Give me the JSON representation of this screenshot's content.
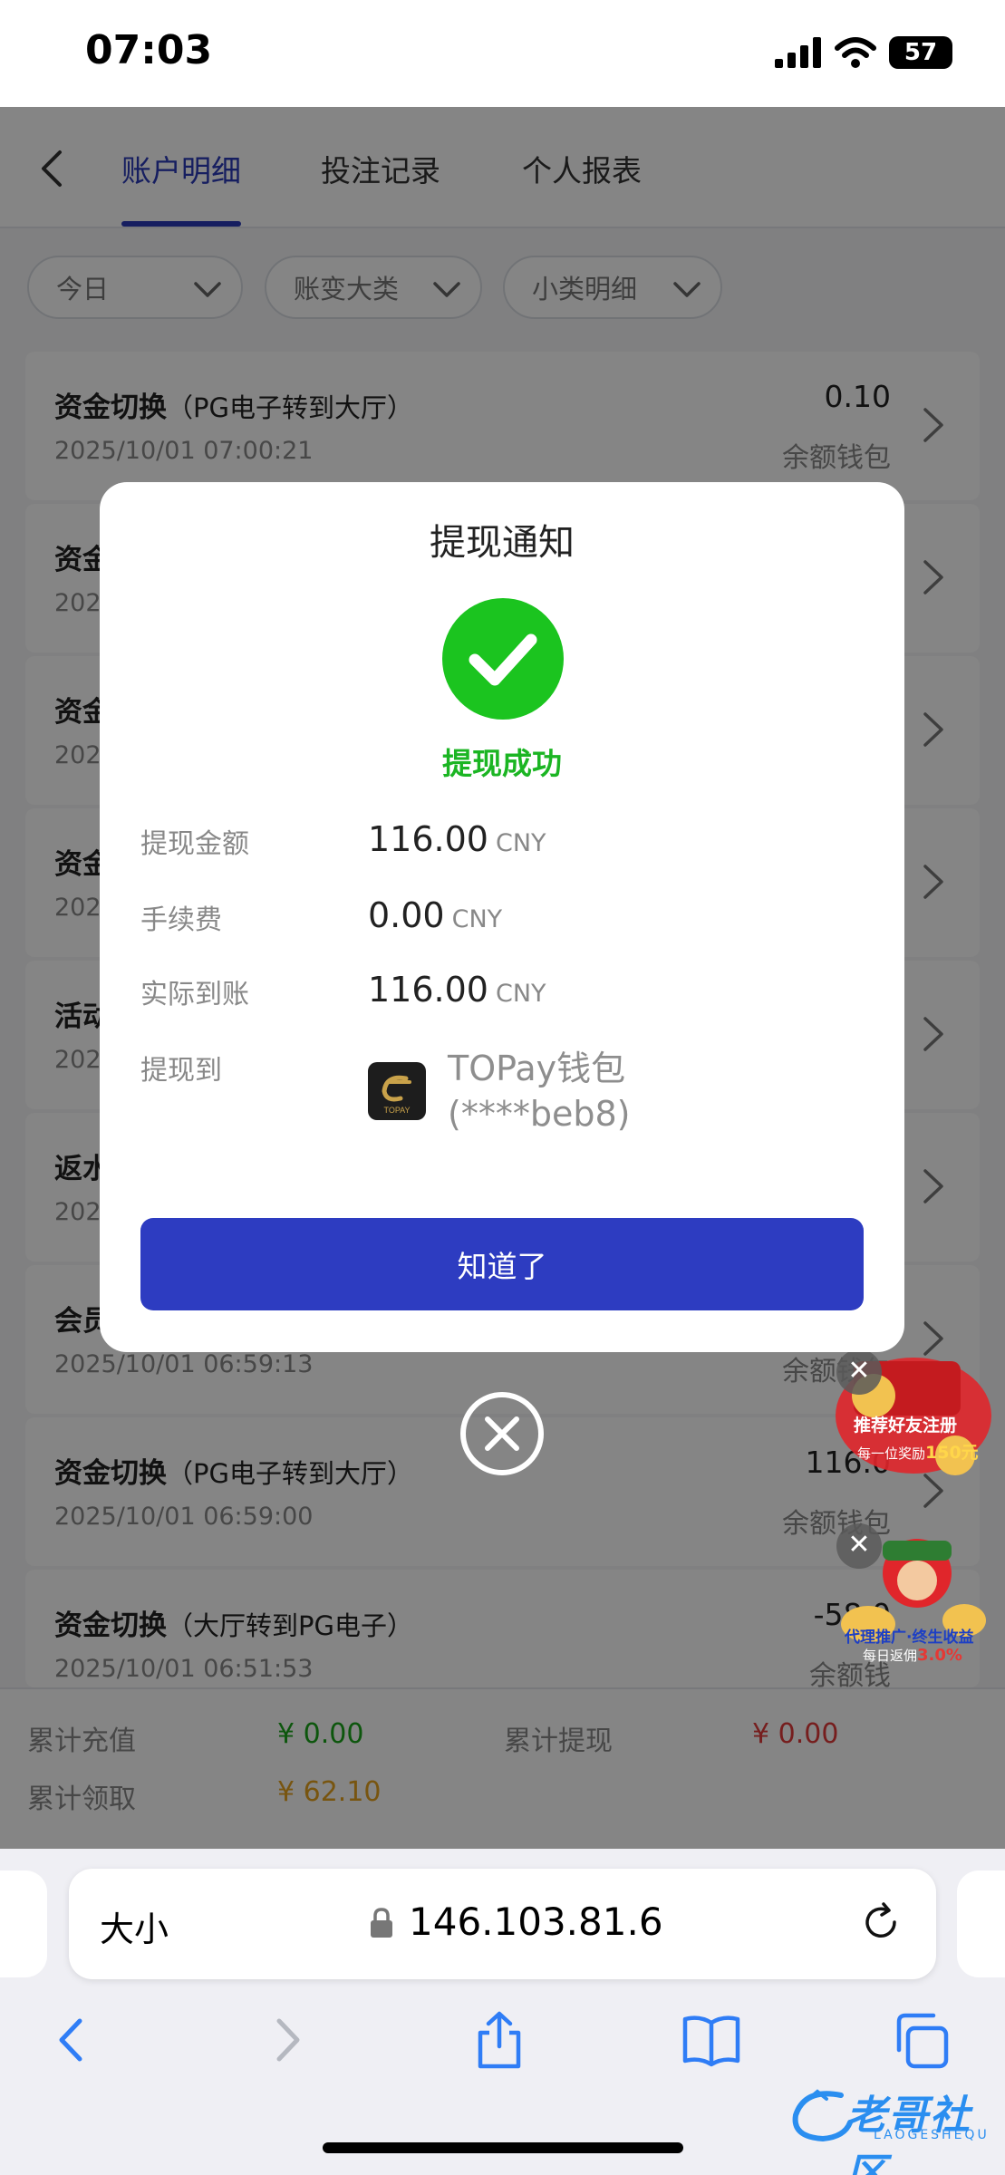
{
  "status_bar": {
    "time": "07:03",
    "battery": "57"
  },
  "nav": {
    "tabs": [
      "账户明细",
      "投注记录",
      "个人报表"
    ]
  },
  "filters": [
    "今日",
    "账变大类",
    "小类明细"
  ],
  "records": [
    {
      "title": "资金切换",
      "sub": "（PG电子转到大厅）",
      "time": "2025/10/01 07:00:21",
      "amount": "0.10",
      "wallet": "余额钱包"
    },
    {
      "title": "资金",
      "sub": "",
      "time": "202",
      "amount": "",
      "wallet": ""
    },
    {
      "title": "资金",
      "sub": "",
      "time": "202",
      "amount": "",
      "wallet": ""
    },
    {
      "title": "资金",
      "sub": "",
      "time": "202",
      "amount": "",
      "wallet": ""
    },
    {
      "title": "活动",
      "sub": "",
      "time": "202",
      "amount": "",
      "wallet": ""
    },
    {
      "title": "返水",
      "sub": "",
      "time": "202",
      "amount": "",
      "wallet": ""
    },
    {
      "title": "会员",
      "sub": "",
      "time": "2025/10/01 06:59:13",
      "amount": "",
      "wallet": "余额钱包"
    },
    {
      "title": "资金切换",
      "sub": "（PG电子转到大厅）",
      "time": "2025/10/01 06:59:00",
      "amount": "116.0",
      "wallet": "余额钱包"
    },
    {
      "title": "资金切换",
      "sub": "（大厅转到PG电子）",
      "time": "2025/10/01 06:51:53",
      "amount": "-58.0",
      "wallet": "余额钱"
    }
  ],
  "summary": {
    "recharge_label": "累计充值",
    "recharge_value": "¥ 0.00",
    "withdraw_label": "累计提现",
    "withdraw_value": "¥ 0.00",
    "claim_label": "累计领取",
    "claim_value": "¥ 62.10",
    "colors": {
      "recharge": "#1aa61a",
      "withdraw": "#e23b3b",
      "claim": "#e7a320"
    }
  },
  "promos": {
    "referral_title": "推荐好友注册",
    "referral_sub": "每一位奖励",
    "referral_amount": "150元",
    "agent_title": "代理推广·终生收益",
    "agent_sub": "每日返佣",
    "agent_rate": "3.0%"
  },
  "modal": {
    "title": "提现通知",
    "status": "提现成功",
    "rows": [
      {
        "label": "提现金额",
        "value": "116.00",
        "unit": "CNY"
      },
      {
        "label": "手续费",
        "value": "0.00",
        "unit": "CNY"
      },
      {
        "label": "实际到账",
        "value": "116.00",
        "unit": "CNY"
      }
    ],
    "destination_label": "提现到",
    "destination_name": "TOPay钱包",
    "destination_account": "(****beb8)",
    "logo_text": "TOPAY",
    "confirm": "知道了",
    "accent": "#2d3cc1",
    "success_color": "#1bc41f"
  },
  "browser": {
    "text_size": "大小",
    "url": "146.103.81.6"
  },
  "watermark": {
    "text": "老哥社区",
    "sub": "LAOGESHEQU"
  }
}
